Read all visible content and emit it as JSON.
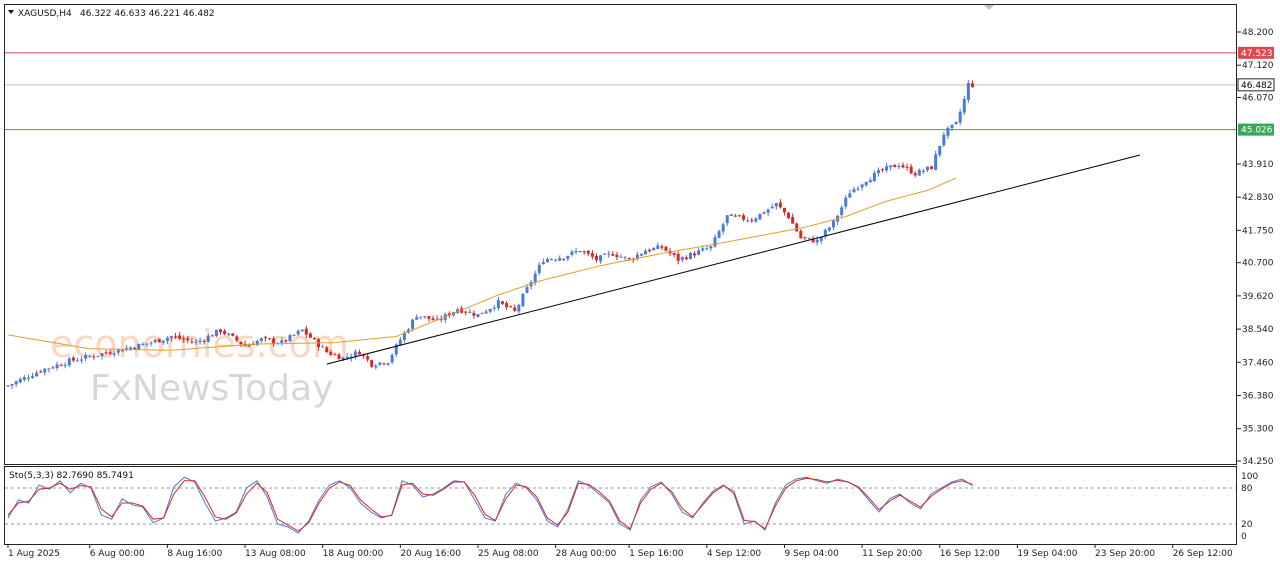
{
  "header": {
    "symbol": "XAGUSD,H4",
    "ohlc": "46.322 46.633 46.221 46.482"
  },
  "watermark": {
    "line1": "economies.com",
    "line2": "FxNewsToday"
  },
  "chart_data": [
    {
      "type": "candlestick",
      "ylim": [
        34.25,
        48.2
      ],
      "y_ticks": [
        "48.200",
        "47.120",
        "46.070",
        "45.026",
        "43.910",
        "42.830",
        "41.750",
        "40.700",
        "39.620",
        "38.540",
        "37.460",
        "36.380",
        "35.300",
        "34.250"
      ],
      "x_ticks": [
        "1 Aug 2025",
        "6 Aug 00:00",
        "8 Aug 16:00",
        "13 Aug 08:00",
        "18 Aug 00:00",
        "20 Aug 16:00",
        "25 Aug 08:00",
        "28 Aug 00:00",
        "1 Sep 16:00",
        "4 Sep 12:00",
        "9 Sep 04:00",
        "11 Sep 20:00",
        "16 Sep 12:00",
        "19 Sep 04:00",
        "23 Sep 20:00",
        "26 Sep 12:00"
      ],
      "levels": [
        {
          "label": "47.523",
          "value": 47.523,
          "color": "#e0474c"
        },
        {
          "label": "46.482",
          "value": 46.482,
          "color": "#c0c0c0"
        },
        {
          "label": "45.026",
          "value": 45.026,
          "color": "#3aa65a"
        }
      ],
      "candle_colors": {
        "up": "#4a7bd6",
        "down": "#d9262b"
      },
      "moving_average_color": "#e0a02a",
      "trendline_color": "#000000",
      "close_path": [
        [
          0,
          36.7
        ],
        [
          8,
          37.2
        ],
        [
          15,
          37.5
        ],
        [
          25,
          37.8
        ],
        [
          32,
          38.0
        ],
        [
          40,
          38.3
        ],
        [
          46,
          38.1
        ],
        [
          52,
          38.5
        ],
        [
          58,
          38.0
        ],
        [
          62,
          38.2
        ],
        [
          67,
          38.1
        ],
        [
          72,
          38.5
        ],
        [
          78,
          37.8
        ],
        [
          82,
          37.6
        ],
        [
          86,
          37.8
        ],
        [
          89,
          37.4
        ],
        [
          93,
          37.5
        ],
        [
          96,
          38.2
        ],
        [
          100,
          39.0
        ],
        [
          105,
          38.8
        ],
        [
          110,
          39.2
        ],
        [
          115,
          39.0
        ],
        [
          120,
          39.4
        ],
        [
          124,
          39.1
        ],
        [
          128,
          40.1
        ],
        [
          131,
          40.8
        ],
        [
          136,
          40.9
        ],
        [
          140,
          41.1
        ],
        [
          144,
          40.8
        ],
        [
          148,
          41.0
        ],
        [
          152,
          40.8
        ],
        [
          156,
          41.1
        ],
        [
          160,
          41.2
        ],
        [
          164,
          40.8
        ],
        [
          168,
          41.0
        ],
        [
          172,
          41.2
        ],
        [
          176,
          42.2
        ],
        [
          182,
          42.1
        ],
        [
          188,
          42.6
        ],
        [
          191,
          42.2
        ],
        [
          194,
          41.5
        ],
        [
          198,
          41.4
        ],
        [
          202,
          42.0
        ],
        [
          206,
          43.0
        ],
        [
          210,
          43.4
        ],
        [
          214,
          43.7
        ],
        [
          218,
          43.9
        ],
        [
          222,
          43.6
        ],
        [
          226,
          43.8
        ],
        [
          229,
          44.9
        ],
        [
          232,
          45.2
        ],
        [
          234,
          46.0
        ],
        [
          235,
          46.5
        ],
        [
          236,
          46.48
        ]
      ],
      "ma_path": [
        [
          0,
          38.35
        ],
        [
          20,
          37.9
        ],
        [
          40,
          37.85
        ],
        [
          60,
          38.05
        ],
        [
          80,
          38.1
        ],
        [
          95,
          38.3
        ],
        [
          110,
          39.1
        ],
        [
          120,
          39.65
        ],
        [
          130,
          40.1
        ],
        [
          145,
          40.6
        ],
        [
          160,
          41.0
        ],
        [
          175,
          41.35
        ],
        [
          185,
          41.6
        ],
        [
          195,
          41.85
        ],
        [
          205,
          42.2
        ],
        [
          215,
          42.7
        ],
        [
          225,
          43.05
        ],
        [
          232,
          43.45
        ]
      ],
      "trendline": {
        "start": [
          78,
          37.4
        ],
        "end": [
          277,
          44.2
        ]
      }
    },
    {
      "type": "line",
      "title": "Sto(5,3,3) 82.7690 85.7491",
      "ylim": [
        0,
        100
      ],
      "y_ticks": [
        "100",
        "80",
        "20",
        "0"
      ],
      "levels": [
        80,
        20
      ],
      "series": [
        {
          "color": "#4a7bd6",
          "values": [
            30,
            60,
            55,
            85,
            78,
            92,
            72,
            88,
            80,
            35,
            28,
            62,
            52,
            48,
            22,
            30,
            82,
            98,
            90,
            55,
            25,
            30,
            40,
            80,
            92,
            65,
            20,
            15,
            5,
            25,
            60,
            85,
            92,
            80,
            55,
            40,
            30,
            35,
            92,
            85,
            65,
            70,
            80,
            92,
            90,
            60,
            30,
            25,
            70,
            88,
            80,
            60,
            25,
            15,
            45,
            92,
            84,
            70,
            55,
            20,
            10,
            60,
            82,
            90,
            70,
            40,
            30,
            55,
            75,
            85,
            70,
            20,
            25,
            10,
            55,
            85,
            95,
            98,
            92,
            88,
            95,
            90,
            80,
            60,
            40,
            62,
            70,
            55,
            45,
            70,
            80,
            90,
            95,
            84
          ]
        },
        {
          "color": "#d9262b",
          "values": [
            35,
            55,
            58,
            78,
            80,
            88,
            78,
            84,
            82,
            45,
            32,
            55,
            55,
            50,
            28,
            30,
            70,
            92,
            92,
            65,
            32,
            28,
            38,
            70,
            88,
            72,
            28,
            18,
            8,
            22,
            55,
            80,
            90,
            84,
            60,
            45,
            32,
            34,
            85,
            88,
            70,
            68,
            78,
            90,
            90,
            68,
            36,
            26,
            62,
            85,
            82,
            65,
            30,
            18,
            40,
            88,
            86,
            74,
            58,
            25,
            12,
            55,
            78,
            88,
            74,
            46,
            32,
            52,
            72,
            84,
            74,
            26,
            24,
            12,
            50,
            80,
            92,
            96,
            94,
            90,
            93,
            90,
            82,
            64,
            44,
            58,
            68,
            58,
            48,
            66,
            78,
            88,
            92,
            86
          ]
        }
      ]
    }
  ]
}
